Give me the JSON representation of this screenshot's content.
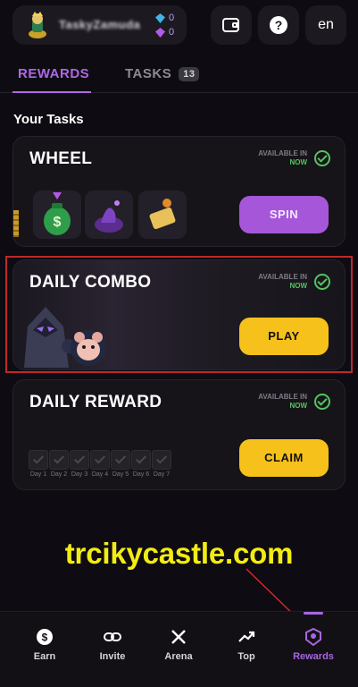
{
  "header": {
    "username": "TaskyZamuda",
    "stats": [
      {
        "value": "0",
        "icon": "blue-gem-icon",
        "color": "#3fb4e6"
      },
      {
        "value": "0",
        "icon": "purple-gem-icon",
        "color": "#b45ae8"
      }
    ],
    "language": "en"
  },
  "tabs": [
    {
      "label": "REWARDS",
      "active": true
    },
    {
      "label": "TASKS",
      "badge": "13",
      "active": false
    }
  ],
  "section_title": "Your Tasks",
  "cards": [
    {
      "title": "WHEEL",
      "available_label": "AVAILABLE IN",
      "available_value": "NOW",
      "button": "SPIN"
    },
    {
      "title": "DAILY COMBO",
      "available_label": "AVAILABLE IN",
      "available_value": "NOW",
      "button": "PLAY"
    },
    {
      "title": "DAILY REWARD",
      "available_label": "AVAILABLE IN",
      "available_value": "NOW",
      "button": "CLAIM",
      "days": [
        "Day 1",
        "Day 2",
        "Day 3",
        "Day 4",
        "Day 5",
        "Day 6",
        "Day 7"
      ]
    }
  ],
  "watermark": "trcikycastle.com",
  "nav": [
    {
      "label": "Earn",
      "icon": "dollar-icon",
      "active": false
    },
    {
      "label": "Invite",
      "icon": "link-icon",
      "active": false
    },
    {
      "label": "Arena",
      "icon": "swords-icon",
      "active": false
    },
    {
      "label": "Top",
      "icon": "trending-up-icon",
      "active": false
    },
    {
      "label": "Rewards",
      "icon": "reward-badge-icon",
      "active": true
    }
  ],
  "colors": {
    "accent": "#b067e6",
    "yellow": "#f6c11b",
    "green": "#56c25f",
    "background": "#0e0c12"
  }
}
